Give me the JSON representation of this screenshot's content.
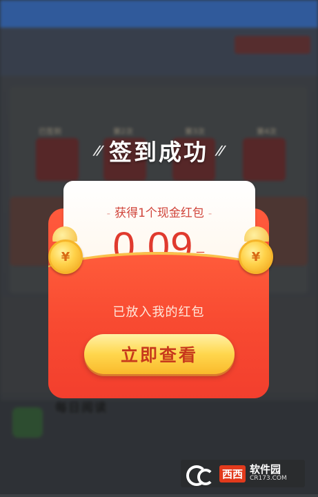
{
  "dialog": {
    "title": "签到成功",
    "title_deco_left": "//",
    "title_deco_right": "//",
    "reward_label": "获得1个现金红包",
    "dash": "-",
    "amount": "0.09",
    "unit": "元",
    "put_in_text": "已放入我的红包",
    "view_button": "立即查看",
    "coin_symbol": "¥"
  },
  "background": {
    "day_labels": [
      "已签到",
      "第2次",
      "第3次",
      "第4次"
    ],
    "bottom_heading": "每日阅读"
  },
  "watermark": {
    "brand": "西西",
    "name": "软件园",
    "url": "CR173.COM"
  },
  "colors": {
    "envelope_red": "#f13b2c",
    "button_gold": "#ffd74d",
    "amount_red": "#e03a2e"
  }
}
